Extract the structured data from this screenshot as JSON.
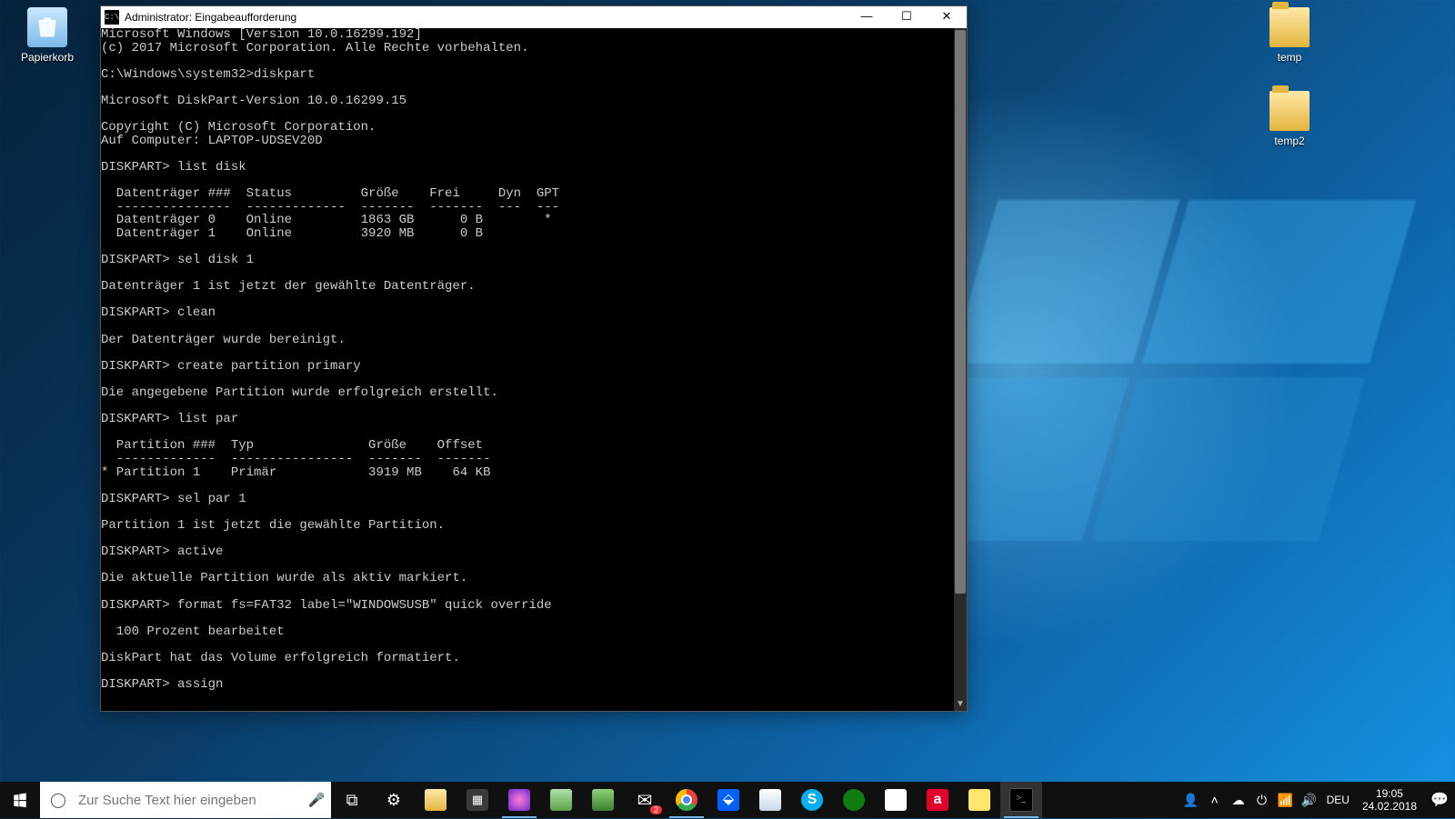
{
  "desktop": {
    "recycle_label": "Papierkorb",
    "folder1_label": "temp",
    "folder2_label": "temp2"
  },
  "window": {
    "title": "Administrator: Eingabeaufforderung",
    "icon_text": "C:\\",
    "minimize": "—",
    "maximize": "☐",
    "close": "✕",
    "terminal": "Microsoft Windows [Version 10.0.16299.192]\n(c) 2017 Microsoft Corporation. Alle Rechte vorbehalten.\n\nC:\\Windows\\system32>diskpart\n\nMicrosoft DiskPart-Version 10.0.16299.15\n\nCopyright (C) Microsoft Corporation.\nAuf Computer: LAPTOP-UDSEV20D\n\nDISKPART> list disk\n\n  Datenträger ###  Status         Größe    Frei     Dyn  GPT\n  ---------------  -------------  -------  -------  ---  ---\n  Datenträger 0    Online         1863 GB      0 B        *\n  Datenträger 1    Online         3920 MB      0 B\n\nDISKPART> sel disk 1\n\nDatenträger 1 ist jetzt der gewählte Datenträger.\n\nDISKPART> clean\n\nDer Datenträger wurde bereinigt.\n\nDISKPART> create partition primary\n\nDie angegebene Partition wurde erfolgreich erstellt.\n\nDISKPART> list par\n\n  Partition ###  Typ               Größe    Offset\n  -------------  ----------------  -------  -------\n* Partition 1    Primär            3919 MB    64 KB\n\nDISKPART> sel par 1\n\nPartition 1 ist jetzt die gewählte Partition.\n\nDISKPART> active\n\nDie aktuelle Partition wurde als aktiv markiert.\n\nDISKPART> format fs=FAT32 label=\"WINDOWSUSB\" quick override\n\n  100 Prozent bearbeitet\n\nDiskPart hat das Volume erfolgreich formatiert.\n\nDISKPART> assign"
  },
  "taskbar": {
    "search_placeholder": "Zur Suche Text hier eingeben",
    "tray": {
      "lang": "DEU",
      "time": "19:05",
      "date": "24.02.2018",
      "mail_badge": "2"
    }
  }
}
